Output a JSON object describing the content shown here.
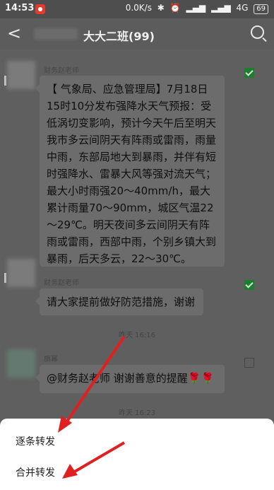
{
  "status": {
    "time": "14:53",
    "network_speed": "0.0K/s",
    "network_type": "4G",
    "battery": "69",
    "icons": [
      "bluetooth-icon",
      "alarm-icon",
      "signal-icon",
      "signal-icon",
      "battery-icon"
    ]
  },
  "header": {
    "title": "大大二班(99)"
  },
  "messages": [
    {
      "sender": "财务赵老师",
      "text": "【 气象局、应急管理局】7月18日15时10分发布强降水天气预报：受低涡切变影响，预计今天午后至明天我市多云间阴天有阵雨或雷雨，雨量中雨，东部局地大到暴雨，并伴有短时强降水、雷暴大风等强对流天气；最大小时雨强20～40mm/h，最大累计雨量70～90mm，城区气温22～29℃。明天夜间多云间阴天有阵雨或雷雨，西部中雨，个别乡镇大到暴雨，后天多云，22～30℃。",
      "selected": true
    },
    {
      "sender": "财务赵老师",
      "text": "请大家提前做好防范措施，谢谢",
      "selected": true
    },
    {
      "sender": "旗幂",
      "text": "@财务赵老师  谢谢善意的提醒🌹🌹",
      "selected": false
    }
  ],
  "timestamps": [
    "昨天 16:16",
    "昨天 16:23"
  ],
  "sheet": {
    "option1": "逐条转发",
    "option2": "合并转发"
  },
  "colors": {
    "annotation_arrow": "#e02020",
    "checkbox_checked": "#1c7f2d"
  }
}
